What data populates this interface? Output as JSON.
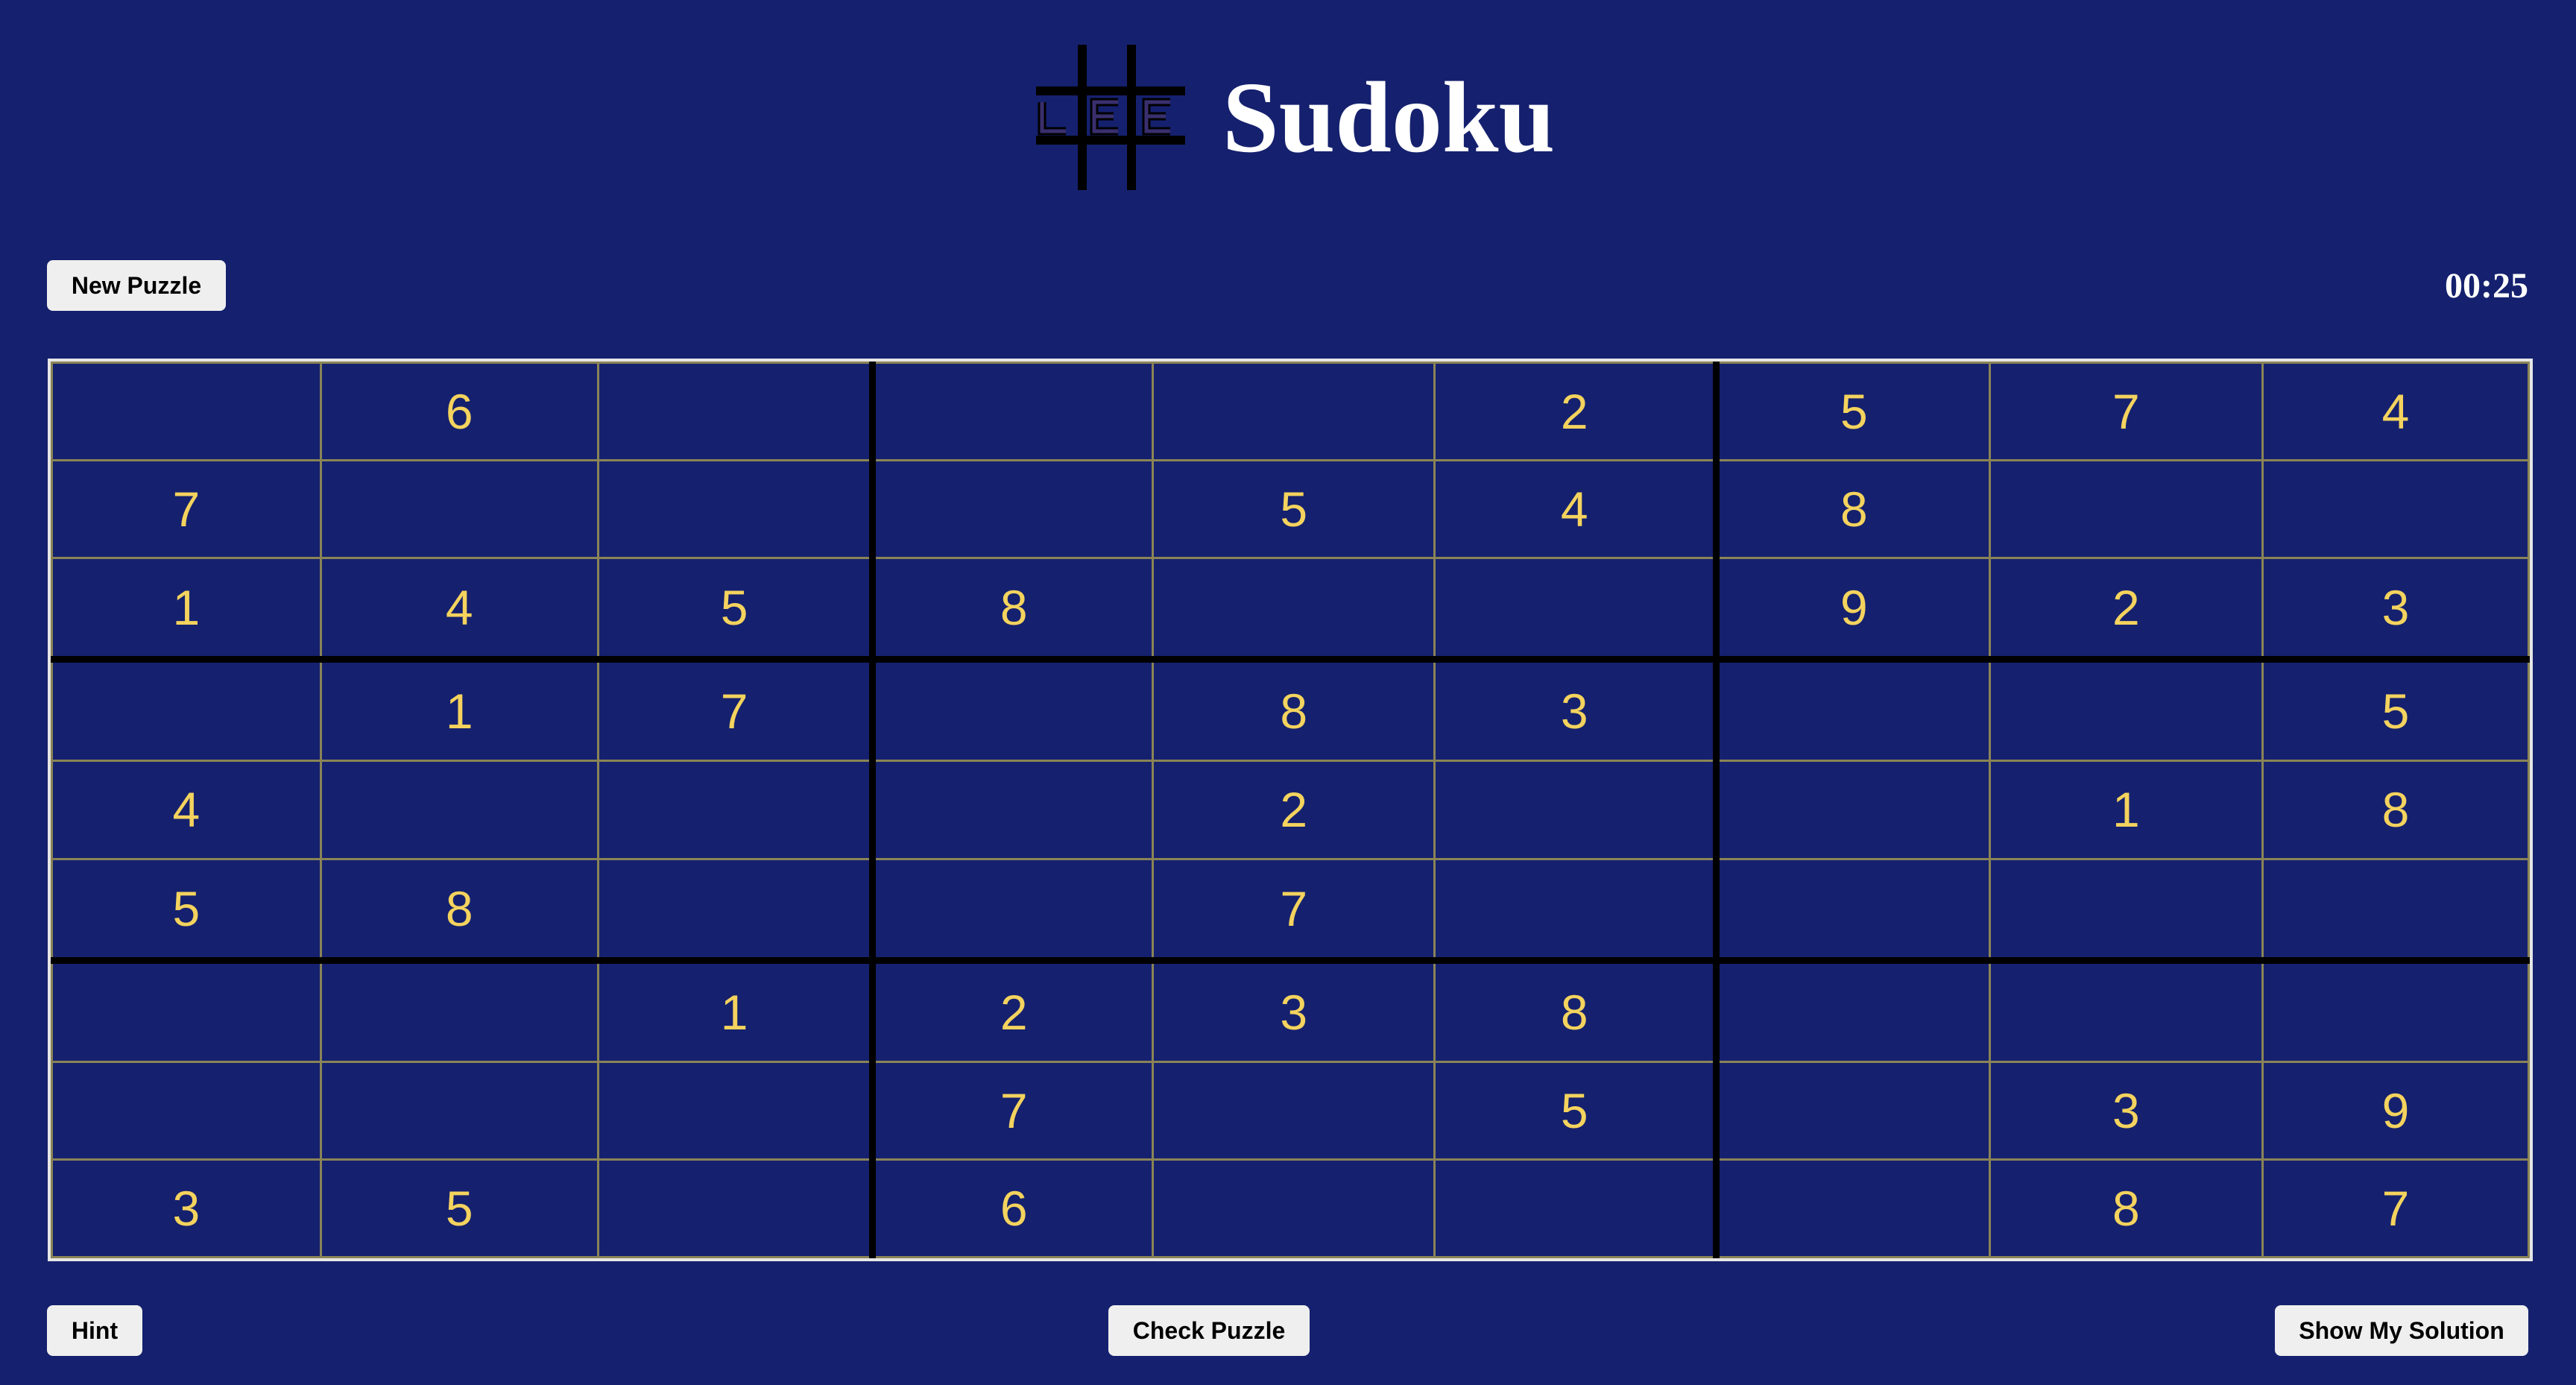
{
  "header": {
    "title": "Sudoku",
    "logo_text": "LEE"
  },
  "controls": {
    "new_puzzle_label": "New Puzzle",
    "timer": "00:25",
    "hint_label": "Hint",
    "check_label": "Check Puzzle",
    "solution_label": "Show My Solution"
  },
  "board": {
    "rows": [
      [
        "",
        "6",
        "",
        "",
        "",
        "2",
        "5",
        "7",
        "4"
      ],
      [
        "7",
        "",
        "",
        "",
        "5",
        "4",
        "8",
        "",
        ""
      ],
      [
        "1",
        "4",
        "5",
        "8",
        "",
        "",
        "9",
        "2",
        "3"
      ],
      [
        "",
        "1",
        "7",
        "",
        "8",
        "3",
        "",
        "",
        "5"
      ],
      [
        "4",
        "",
        "",
        "",
        "2",
        "",
        "",
        "1",
        "8"
      ],
      [
        "5",
        "8",
        "",
        "",
        "7",
        "",
        "",
        "",
        ""
      ],
      [
        "",
        "",
        "1",
        "2",
        "3",
        "8",
        "",
        "",
        ""
      ],
      [
        "",
        "",
        "",
        "7",
        "",
        "5",
        "",
        "3",
        "9"
      ],
      [
        "3",
        "5",
        "",
        "6",
        "",
        "",
        "",
        "8",
        "7"
      ]
    ]
  },
  "colors": {
    "background": "#15216e",
    "digit": "#f4d35e",
    "cell_border": "#8a8457",
    "box_border": "#000000"
  }
}
